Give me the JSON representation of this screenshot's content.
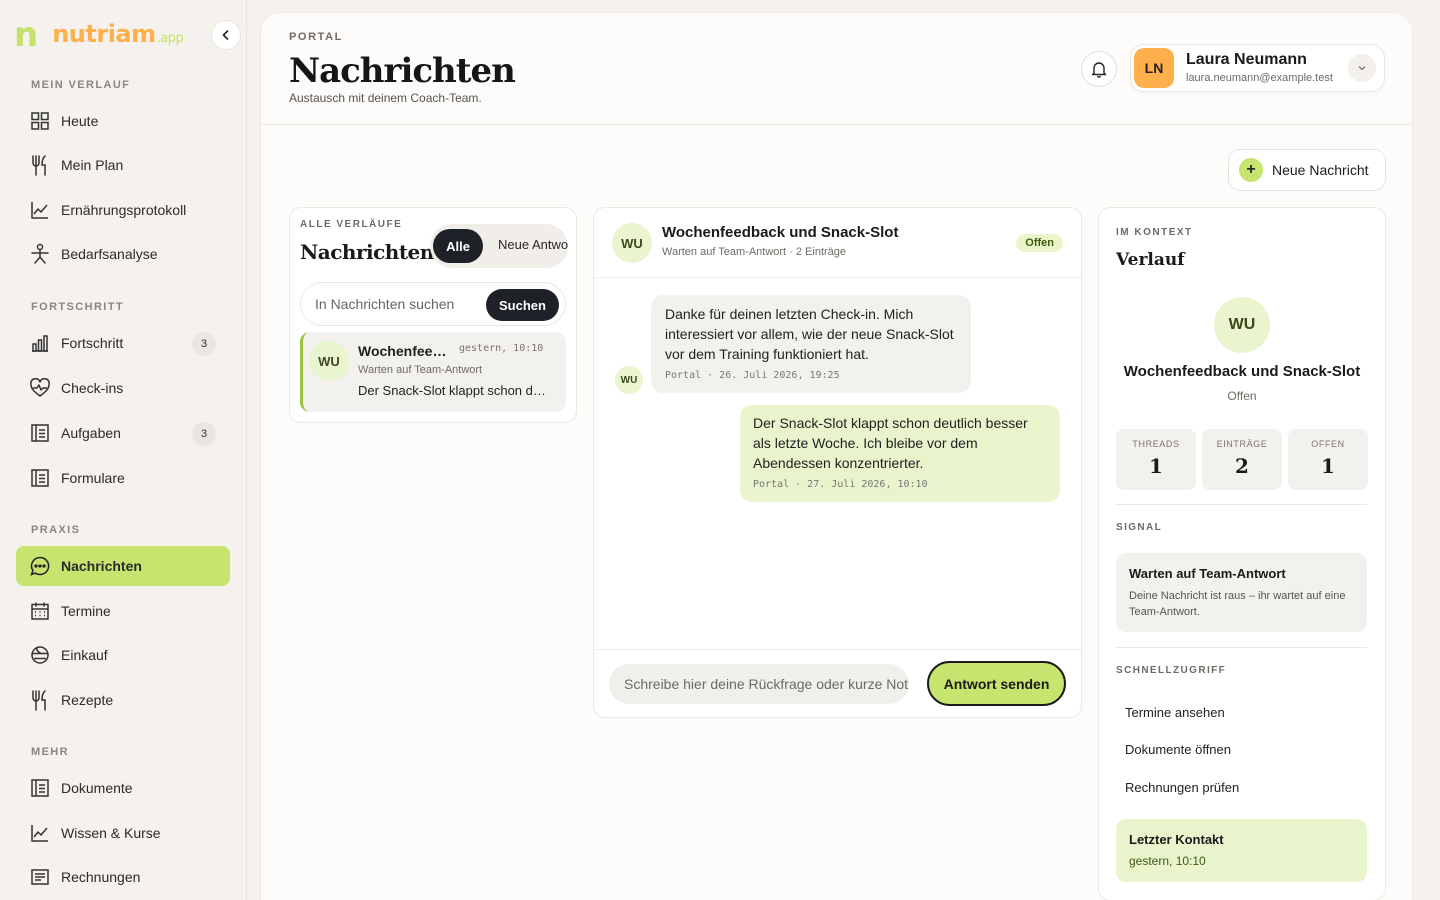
{
  "brand": {
    "logo_letter": "n",
    "name": "nutriam",
    "suffix": ".app"
  },
  "sidebar": {
    "sections": [
      {
        "title": "MEIN VERLAUF",
        "items": [
          {
            "label": "Heute",
            "icon": "grid-icon"
          },
          {
            "label": "Mein Plan",
            "icon": "fork-knife-icon"
          },
          {
            "label": "Ernährungsprotokoll",
            "icon": "trend-chart-icon"
          },
          {
            "label": "Bedarfsanalyse",
            "icon": "person-icon"
          }
        ]
      },
      {
        "title": "FORTSCHRITT",
        "items": [
          {
            "label": "Fortschritt",
            "icon": "bar-chart-icon",
            "badge": "3"
          },
          {
            "label": "Check-ins",
            "icon": "heart-pulse-icon"
          },
          {
            "label": "Aufgaben",
            "icon": "document-icon",
            "badge": "3"
          },
          {
            "label": "Formulare",
            "icon": "form-icon"
          }
        ]
      },
      {
        "title": "PRAXIS",
        "items": [
          {
            "label": "Nachrichten",
            "icon": "chat-icon",
            "active": true
          },
          {
            "label": "Termine",
            "icon": "calendar-icon"
          },
          {
            "label": "Einkauf",
            "icon": "basket-icon"
          },
          {
            "label": "Rezepte",
            "icon": "fork-knife-icon"
          }
        ]
      },
      {
        "title": "MEHR",
        "items": [
          {
            "label": "Dokumente",
            "icon": "document-icon"
          },
          {
            "label": "Wissen & Kurse",
            "icon": "trend-chart-icon"
          },
          {
            "label": "Rechnungen",
            "icon": "invoice-icon"
          }
        ]
      }
    ]
  },
  "header": {
    "eyebrow": "PORTAL",
    "title": "Nachrichten",
    "subtitle": "Austausch mit deinem Coach-Team.",
    "user": {
      "initials": "LN",
      "name": "Laura Neumann",
      "email": "laura.neumann@example.test"
    }
  },
  "actions": {
    "new_message": "Neue Nachricht"
  },
  "list": {
    "eyebrow": "ALLE VERLÄUFE",
    "title": "Nachrichten",
    "filter_all": "Alle",
    "filter_new": "Neue Antworten",
    "search_placeholder": "In Nachrichten suchen",
    "search_button": "Suchen",
    "threads": [
      {
        "initials": "WU",
        "title": "Wochenfeedback und Snack-Slot",
        "time": "gestern, 10:10",
        "status": "Warten auf Team-Antwort",
        "preview": "Der Snack-Slot klappt schon deutlich besser"
      }
    ]
  },
  "chat": {
    "initials": "WU",
    "title": "Wochenfeedback und Snack-Slot",
    "subtitle": "Warten auf Team-Antwort · 2 Einträge",
    "status": "Offen",
    "messages": [
      {
        "from": "team",
        "initials": "WU",
        "text": "Danke für deinen letzten Check-in. Mich interessiert vor allem, wie der neue Snack-Slot vor dem Training funktioniert hat.",
        "meta": "Portal · 26. Juli 2026, 19:25"
      },
      {
        "from": "me",
        "text": "Der Snack-Slot klappt schon deutlich besser als letzte Woche. Ich bleibe vor dem Abendessen konzentrierter.",
        "meta": "Portal · 27. Juli 2026, 10:10"
      }
    ],
    "reply_placeholder": "Schreibe hier deine Rückfrage oder kurze Notiz",
    "send_button": "Antwort senden"
  },
  "context": {
    "eyebrow": "IM KONTEXT",
    "title": "Verlauf",
    "initials": "WU",
    "thread_title": "Wochenfeedback und Snack-Slot",
    "thread_status": "Offen",
    "stats": [
      {
        "label": "THREADS",
        "value": "1"
      },
      {
        "label": "EINTRÄGE",
        "value": "2"
      },
      {
        "label": "OFFEN",
        "value": "1"
      }
    ],
    "signal_label": "SIGNAL",
    "signal_title": "Warten auf Team-Antwort",
    "signal_text": "Deine Nachricht ist raus – ihr wartet auf eine Team-Antwort.",
    "quick_label": "SCHNELLZUGRIFF",
    "quick_links": [
      "Termine ansehen",
      "Dokumente öffnen",
      "Rechnungen prüfen"
    ],
    "last_contact_label": "Letzter Kontakt",
    "last_contact_value": "gestern, 10:10"
  },
  "colors": {
    "accent": "#c6e46e",
    "brand_orange": "#ffb04a",
    "dark": "#1e2128",
    "mint": "#e9f5cf"
  }
}
